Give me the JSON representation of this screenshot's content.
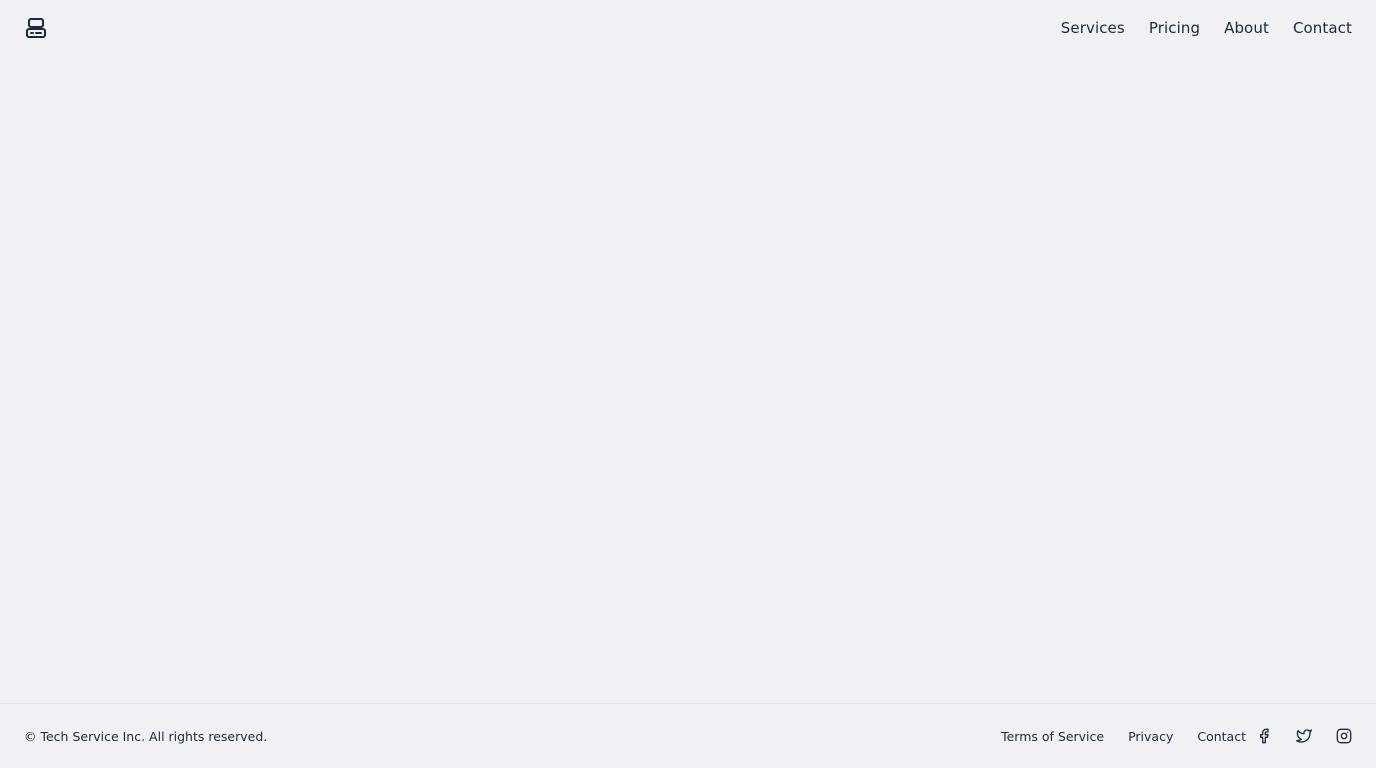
{
  "header": {
    "logo_icon": "server-icon",
    "nav": [
      {
        "label": "Services"
      },
      {
        "label": "Pricing"
      },
      {
        "label": "About"
      },
      {
        "label": "Contact"
      }
    ]
  },
  "footer": {
    "copyright": "© Tech Service Inc. All rights reserved.",
    "links": [
      {
        "label": "Terms of Service"
      },
      {
        "label": "Privacy"
      },
      {
        "label": "Contact"
      }
    ],
    "social": [
      {
        "icon": "facebook-icon"
      },
      {
        "icon": "twitter-icon"
      },
      {
        "icon": "instagram-icon"
      }
    ]
  },
  "colors": {
    "background": "#eff1f5",
    "text": "#1e293b",
    "divider": "#e2e5ec"
  }
}
